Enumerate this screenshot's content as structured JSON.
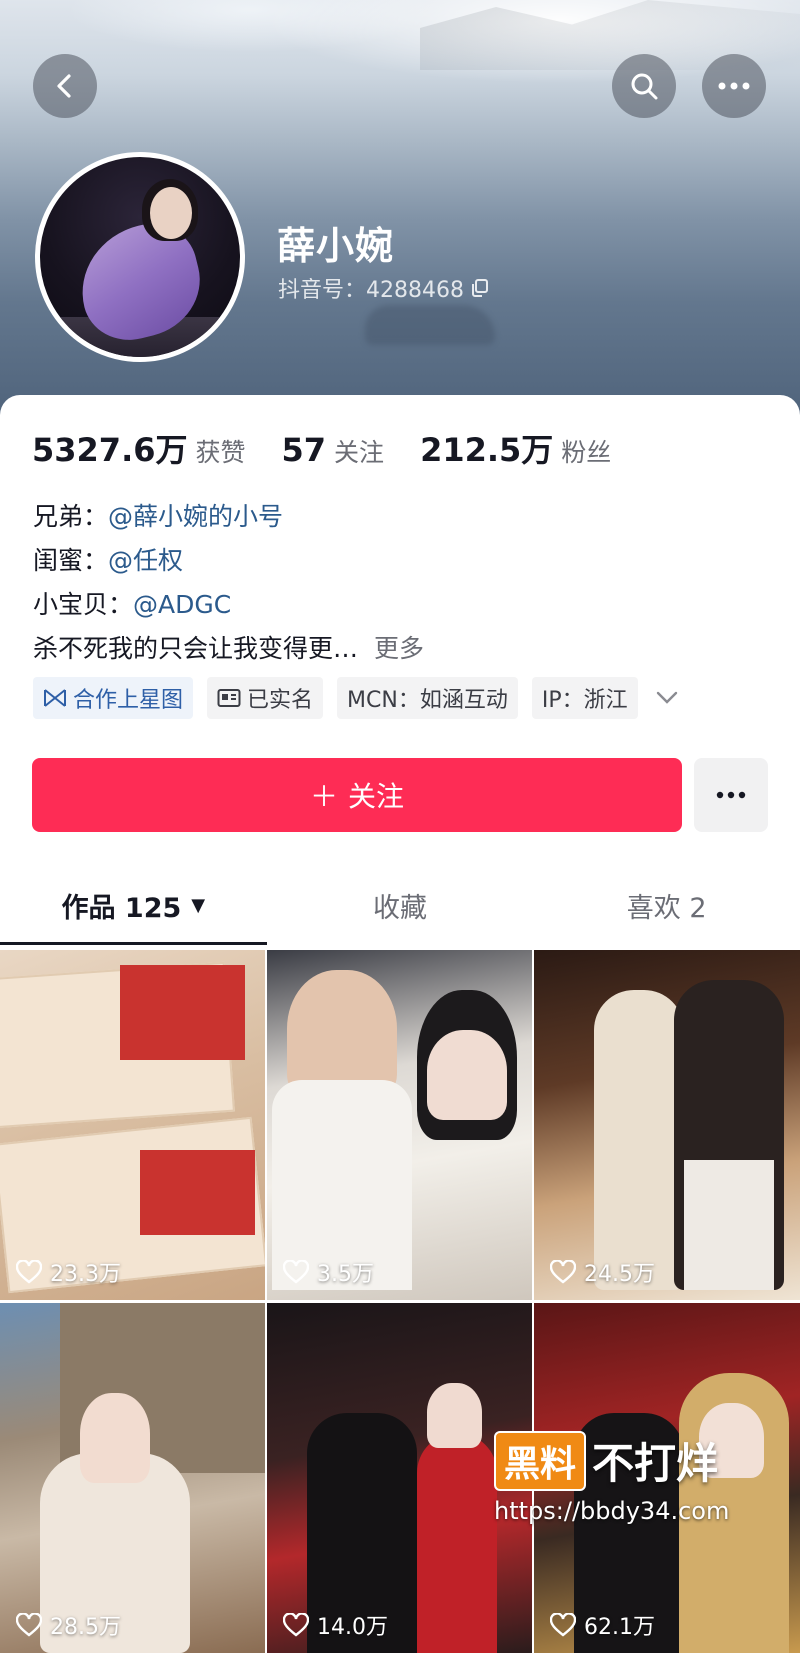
{
  "profile": {
    "nickname": "薛小婉",
    "douyin_id": "抖音号：4288468"
  },
  "stats": [
    {
      "value": "5327.6万",
      "label": "获赞"
    },
    {
      "value": "57",
      "label": "关注"
    },
    {
      "value": "212.5万",
      "label": "粉丝"
    }
  ],
  "bio": {
    "row1_label": "兄弟：",
    "row1_mention": "@薛小婉的小号",
    "row2_label": "闺蜜：",
    "row2_mention": "@任权",
    "row3_label": "小宝贝：",
    "row3_mention": "@ADGC",
    "signature": "杀不死我的只会让我变得更…",
    "more": "更多"
  },
  "tags": {
    "star": "合作上星图",
    "verified": "已实名",
    "mcn": "MCN：如涵互动",
    "ip": "IP：浙江"
  },
  "actions": {
    "follow": "关注",
    "follow_plus": "＋"
  },
  "tabs": [
    {
      "label": "作品 125",
      "caret": "▼"
    },
    {
      "label": "收藏"
    },
    {
      "label": "喜欢 2"
    }
  ],
  "videos": [
    {
      "likes": "23.3万"
    },
    {
      "likes": "3.5万"
    },
    {
      "likes": "24.5万"
    },
    {
      "likes": "28.5万"
    },
    {
      "likes": "14.0万"
    },
    {
      "likes": "62.1万"
    }
  ],
  "watermark": {
    "badge": "黑料",
    "brand": "不打烊",
    "url": "https://bbdy34.com"
  },
  "colors": {
    "accent": "#fe2c55",
    "mention": "#2b5a8c"
  },
  "icons": [
    "back-icon",
    "search-icon",
    "more-icon",
    "copy-icon",
    "star-map-icon",
    "id-card-icon",
    "chevron-down-icon",
    "heart-icon"
  ]
}
